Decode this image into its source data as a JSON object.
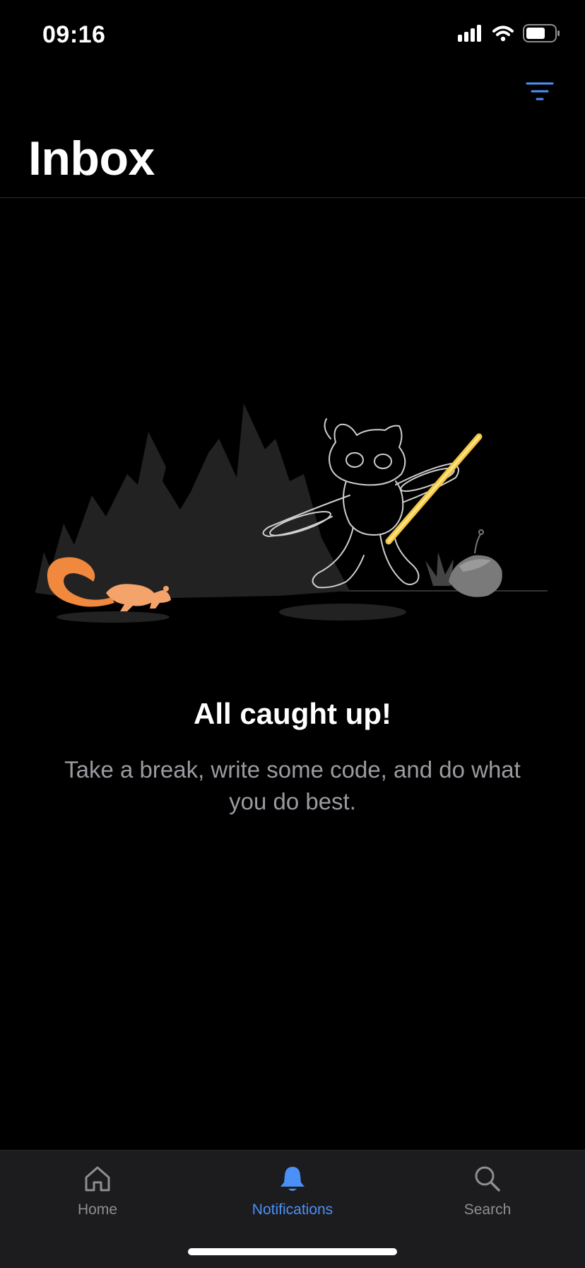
{
  "status_bar": {
    "time": "09:16",
    "icons": [
      "cellular-signal-icon",
      "wifi-icon",
      "battery-icon"
    ]
  },
  "header": {
    "title": "Inbox",
    "filter_icon": "filter-icon"
  },
  "empty_state": {
    "heading": "All caught up!",
    "message": "Take a break, write some code, and do what you do best.",
    "illustration": "octocat-and-squirrel-illustration"
  },
  "tab_bar": {
    "tabs": [
      {
        "label": "Home",
        "icon": "home-icon",
        "active": false
      },
      {
        "label": "Notifications",
        "icon": "bell-icon",
        "active": true
      },
      {
        "label": "Search",
        "icon": "search-icon",
        "active": false
      }
    ]
  },
  "colors": {
    "background": "#000000",
    "accent": "#4a90f7",
    "secondary_text": "#9a9aa0",
    "tab_bar_background": "#1c1c1e",
    "squirrel": "#f0883e",
    "lightsaber": "#f2c744"
  }
}
